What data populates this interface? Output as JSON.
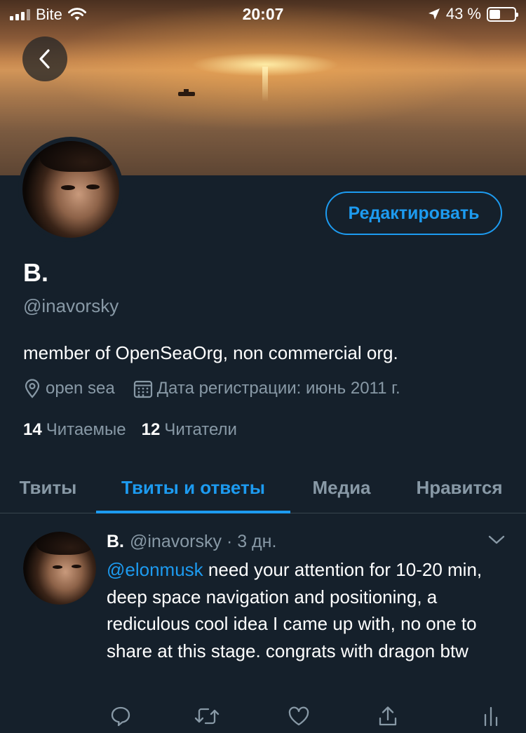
{
  "status_bar": {
    "carrier": "Bite",
    "time": "20:07",
    "battery_percent": "43 %",
    "battery_level": 0.43
  },
  "profile": {
    "edit_label": "Редактировать",
    "display_name": "B.",
    "handle": "@inavorsky",
    "bio": "member of OpenSeaOrg, non commercial org.",
    "location": "open sea",
    "joined": "Дата регистрации: июнь 2011 г.",
    "following_count": "14",
    "following_label": "Читаемые",
    "followers_count": "12",
    "followers_label": "Читатели"
  },
  "tabs": [
    {
      "label": "Твиты",
      "active": false
    },
    {
      "label": "Твиты и ответы",
      "active": true
    },
    {
      "label": "Медиа",
      "active": false
    },
    {
      "label": "Нравится",
      "active": false
    }
  ],
  "tweet": {
    "name": "B.",
    "handle": "@inavorsky",
    "time": "· 3 дн.",
    "mention": "@elonmusk",
    "text": " need your attention for 10-20 min, deep space navigation and positioning, a rediculous cool idea I came up with, no one to share at this stage. congrats with dragon btw"
  },
  "icons": {
    "back": "chevron-left-icon",
    "location": "map-pin-icon",
    "calendar": "calendar-icon",
    "reply": "comment-icon",
    "retweet": "retweet-icon",
    "like": "heart-icon",
    "share": "share-icon",
    "analytics": "analytics-icon"
  },
  "colors": {
    "background": "#15202b",
    "accent": "#1d9bf0",
    "secondary_text": "#8899a6"
  }
}
